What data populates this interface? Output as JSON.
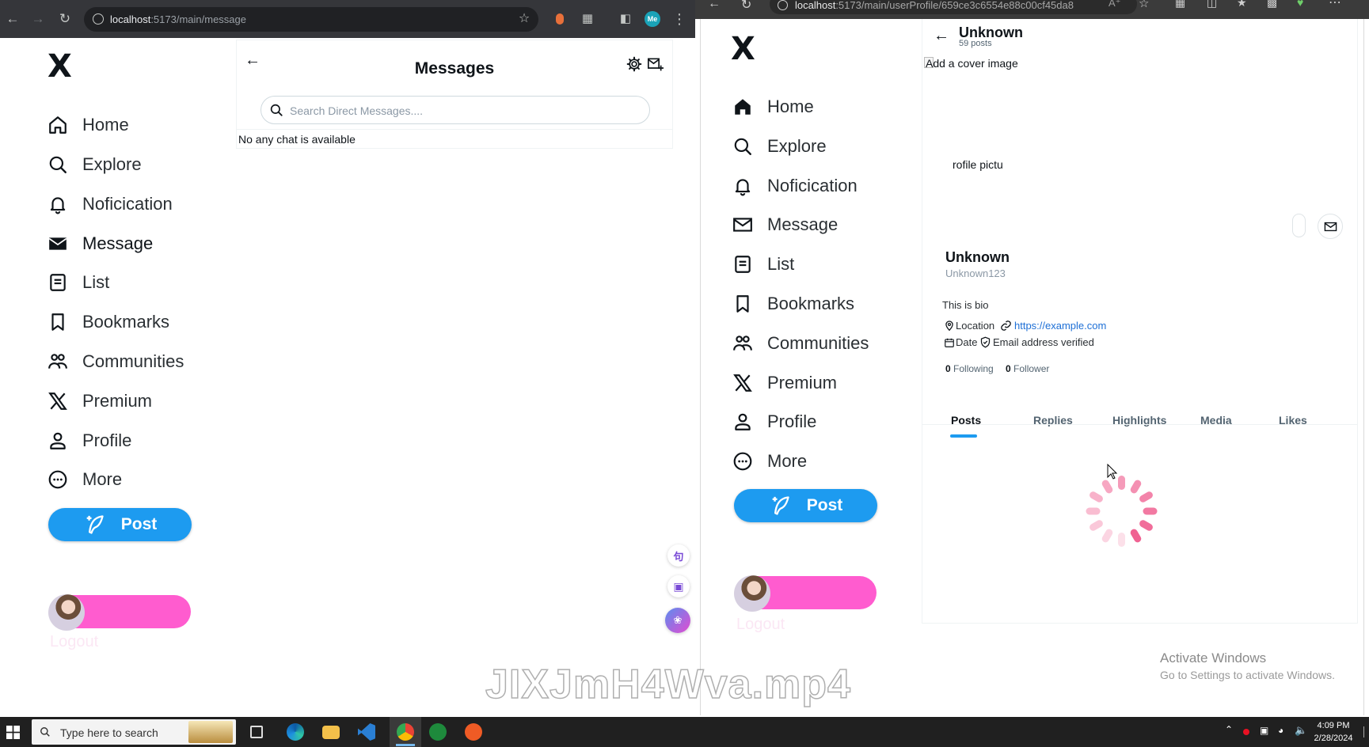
{
  "left_browser": {
    "url_host": "localhost",
    "url_path": ":5173/main/message",
    "profile_badge": "Me"
  },
  "right_browser": {
    "url_host": "localhost",
    "url_path": ":5173/main/userProfile/659ce3c6554e88c00cf45da8"
  },
  "sidebar": {
    "logo": "X",
    "items": [
      {
        "label": "Home",
        "icon": "home-icon"
      },
      {
        "label": "Explore",
        "icon": "search-icon"
      },
      {
        "label": "Noficication",
        "icon": "bell-icon"
      },
      {
        "label": "Message",
        "icon": "mail-icon"
      },
      {
        "label": "List",
        "icon": "list-icon"
      },
      {
        "label": "Bookmarks",
        "icon": "bookmark-icon"
      },
      {
        "label": "Communities",
        "icon": "people-icon"
      },
      {
        "label": "Premium",
        "icon": "x-logo-icon"
      },
      {
        "label": "Profile",
        "icon": "person-icon"
      },
      {
        "label": "More",
        "icon": "more-icon"
      }
    ],
    "post_label": "Post",
    "logout_label": "Logout"
  },
  "messages": {
    "title": "Messages",
    "search_placeholder": "Search Direct Messages....",
    "empty_text": "No any chat is available"
  },
  "profile": {
    "header_name": "Unknown",
    "posts_count": "59 posts",
    "cover_alt": "Add a cover image",
    "profile_pic_alt": "rofile pictu",
    "name": "Unknown",
    "handle": "Unknown123",
    "bio": "This is bio",
    "location": "Location",
    "website": "https://example.com",
    "date": "Date",
    "email_status": "Email address verified",
    "following_count": "0",
    "following_label": "Following",
    "follower_count": "0",
    "follower_label": "Follower",
    "tabs": [
      "Posts",
      "Replies",
      "Highlights",
      "Media",
      "Likes"
    ],
    "active_tab": "Posts"
  },
  "taskbar": {
    "search_placeholder": "Type here to search",
    "time": "4:09 PM",
    "date": "2/28/2024"
  },
  "overlay": {
    "watermark": "JIXJmH4Wva.mp4",
    "activate_title": "Activate Windows",
    "activate_sub": "Go to Settings to activate Windows."
  },
  "colors": {
    "accent": "#1d9bf0",
    "user_pill": "#ff5ccf",
    "spinner": "#f06292"
  }
}
